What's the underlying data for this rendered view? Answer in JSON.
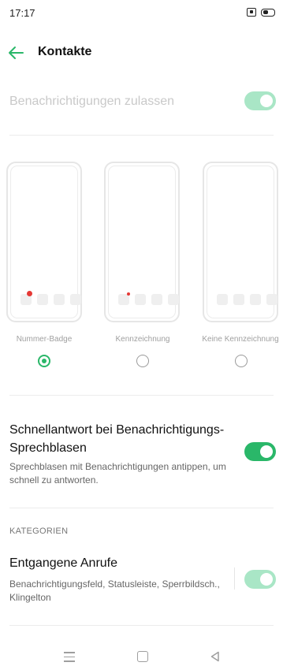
{
  "status_bar": {
    "time": "17:17",
    "icons": [
      "sim-icon",
      "battery-icon"
    ]
  },
  "header": {
    "back_icon": "arrow-left-icon",
    "title": "Kontakte"
  },
  "allow": {
    "label": "Benachrichtigungen zulassen",
    "enabled": true,
    "disabled": true
  },
  "badge_options": [
    {
      "label": "Nummer-Badge",
      "selected": true
    },
    {
      "label": "Kennzeichnung",
      "selected": false
    },
    {
      "label": "Keine Kennzeichnung",
      "selected": false
    }
  ],
  "quick_reply": {
    "title": "Schnellantwort bei Benachrichtigungs-Sprechblasen",
    "description": "Sprechblasen mit Benachrichtigungen antippen, um schnell zu antworten.",
    "enabled": true
  },
  "categories": {
    "header": "KATEGORIEN",
    "items": [
      {
        "title": "Entgangene Anrufe",
        "description": "Benachrichtigungsfeld, Statusleiste, Sperrbildsch., Klingelton",
        "enabled": true
      }
    ]
  },
  "nav_bar": {
    "icons": [
      "menu-icon",
      "home-icon",
      "back-icon"
    ]
  },
  "colors": {
    "accent": "#2ab769",
    "accent_disabled": "#a9e6c6",
    "badge": "#e53935"
  }
}
